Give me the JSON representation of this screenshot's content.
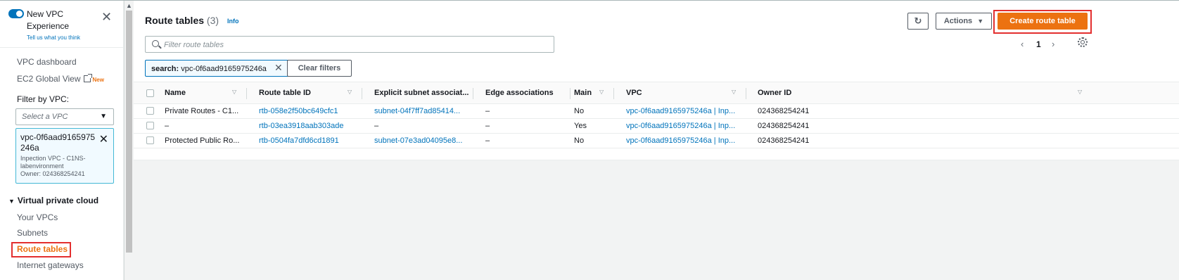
{
  "sidebar": {
    "new_vpc_title": "New VPC Experience",
    "feedback_link": "Tell us what you think",
    "dashboard_link": "VPC dashboard",
    "ec2_link": "EC2 Global View",
    "new_badge": "New",
    "filter_label": "Filter by VPC:",
    "vpc_select_placeholder": "Select a VPC",
    "selected_vpc": {
      "id": "vpc-0f6aad9165975246a",
      "name": "Inpection VPC - C1NS-labenvironment",
      "owner": "Owner: 024368254241"
    },
    "section_header": "Virtual private cloud",
    "items": [
      {
        "label": "Your VPCs"
      },
      {
        "label": "Subnets"
      },
      {
        "label": "Route tables"
      },
      {
        "label": "Internet gateways"
      }
    ]
  },
  "header": {
    "title": "Route tables",
    "count": "(3)",
    "info": "Info",
    "actions_label": "Actions",
    "create_label": "Create route table"
  },
  "search": {
    "placeholder": "Filter route tables",
    "token_key": "search:",
    "token_value": "vpc-0f6aad9165975246a",
    "clear_label": "Clear filters"
  },
  "pagination": {
    "current_page": "1"
  },
  "table": {
    "columns": [
      "Name",
      "Route table ID",
      "Explicit subnet associat...",
      "Edge associations",
      "Main",
      "VPC",
      "Owner ID"
    ],
    "rows": [
      {
        "name": "Private Routes - C1...",
        "id": "rtb-058e2f50bc649cfc1",
        "subnet": "subnet-04f7ff7ad85414...",
        "edge": "–",
        "main": "No",
        "vpc": "vpc-0f6aad9165975246a | Inp...",
        "owner": "024368254241"
      },
      {
        "name": "–",
        "id": "rtb-03ea3918aab303ade",
        "subnet": "–",
        "edge": "–",
        "main": "Yes",
        "vpc": "vpc-0f6aad9165975246a | Inp...",
        "owner": "024368254241"
      },
      {
        "name": "Protected Public Ro...",
        "id": "rtb-0504fa7dfd6cd1891",
        "subnet": "subnet-07e3ad04095e8...",
        "edge": "–",
        "main": "No",
        "vpc": "vpc-0f6aad9165975246a | Inp...",
        "owner": "024368254241"
      }
    ]
  },
  "colors": {
    "accent": "#ec7211",
    "link": "#0073bb",
    "highlight": "#e32f2f"
  }
}
